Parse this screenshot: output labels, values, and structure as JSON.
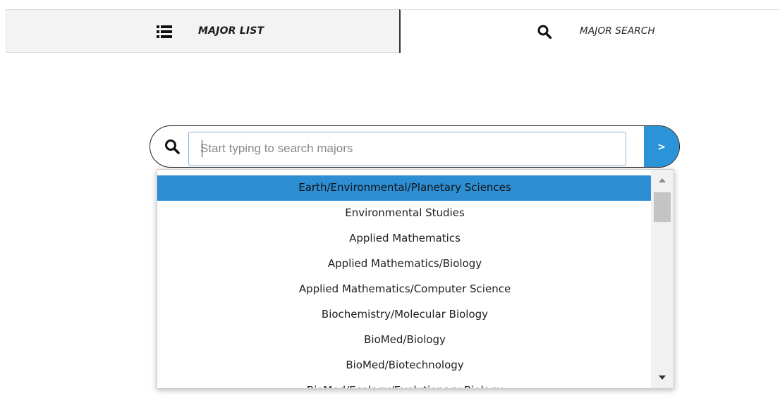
{
  "tabs": {
    "list": {
      "label": "MAJOR LIST",
      "icon": "list-icon"
    },
    "search": {
      "label": "MAJOR SEARCH",
      "icon": "search-icon"
    }
  },
  "search": {
    "icon": "search-icon",
    "value": "",
    "placeholder": "Start typing to search majors",
    "submit_label": ">"
  },
  "dropdown": {
    "items": [
      "Earth/Environmental/Planetary Sciences",
      "Environmental Studies",
      "Applied Mathematics",
      "Applied Mathematics/Biology",
      "Applied Mathematics/Computer Science",
      "Biochemistry/Molecular Biology",
      "BioMed/Biology",
      "BioMed/Biotechnology",
      "BioMed/Ecology/Evolutionary Biology"
    ],
    "active_index": 0
  },
  "colors": {
    "accent": "#2e8ed4",
    "button": "#2b93d8",
    "tab_inactive_bg": "#f3f3f3"
  }
}
